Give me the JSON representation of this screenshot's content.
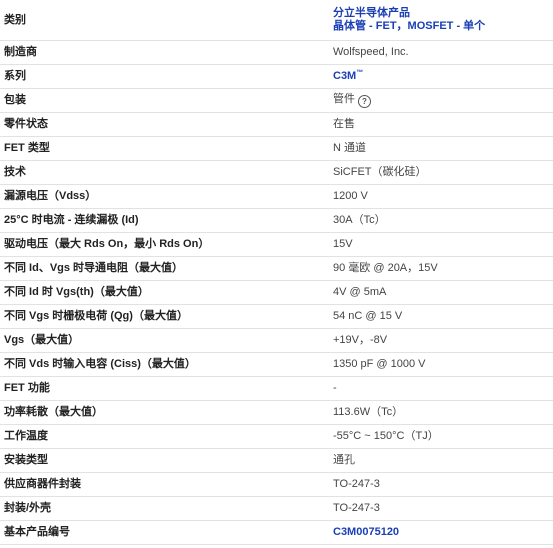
{
  "rows": [
    {
      "label": "类别",
      "value_lines": [
        "分立半导体产品",
        "晶体管 - FET，MOSFET - 单个"
      ],
      "link": true
    },
    {
      "label": "制造商",
      "value": "Wolfspeed, Inc."
    },
    {
      "label": "系列",
      "value": "C3M",
      "superscript": "™",
      "link": true
    },
    {
      "label": "包装",
      "value": "管件",
      "help_icon": "question-circle-icon"
    },
    {
      "label": "零件状态",
      "value": "在售"
    },
    {
      "label": "FET 类型",
      "value": "N 通道"
    },
    {
      "label": "技术",
      "value": "SiCFET（碳化硅）"
    },
    {
      "label": "漏源电压（Vdss）",
      "value": "1200 V"
    },
    {
      "label": "25°C 时电流 - 连续漏极 (Id)",
      "value": "30A（Tc）"
    },
    {
      "label": "驱动电压（最大 Rds On，最小 Rds On）",
      "value": "15V"
    },
    {
      "label": "不同 Id、Vgs 时导通电阻（最大值）",
      "value": "90 毫欧 @ 20A，15V"
    },
    {
      "label": "不同 Id 时 Vgs(th)（最大值）",
      "value": "4V @ 5mA"
    },
    {
      "label": "不同 Vgs 时栅极电荷 (Qg)（最大值）",
      "value": "54 nC @ 15 V"
    },
    {
      "label": "Vgs（最大值）",
      "value": "+19V，-8V"
    },
    {
      "label": "不同 Vds 时输入电容 (Ciss)（最大值）",
      "value": "1350 pF @ 1000 V"
    },
    {
      "label": "FET 功能",
      "value": "-"
    },
    {
      "label": "功率耗散（最大值）",
      "value": "113.6W（Tc）"
    },
    {
      "label": "工作温度",
      "value": "-55°C ~ 150°C（TJ）"
    },
    {
      "label": "安装类型",
      "value": "通孔"
    },
    {
      "label": "供应商器件封装",
      "value": "TO-247-3"
    },
    {
      "label": "封装/外壳",
      "value": "TO-247-3"
    },
    {
      "label": "基本产品编号",
      "value": "C3M0075120",
      "link": true
    }
  ],
  "help_icon_glyph": "?"
}
